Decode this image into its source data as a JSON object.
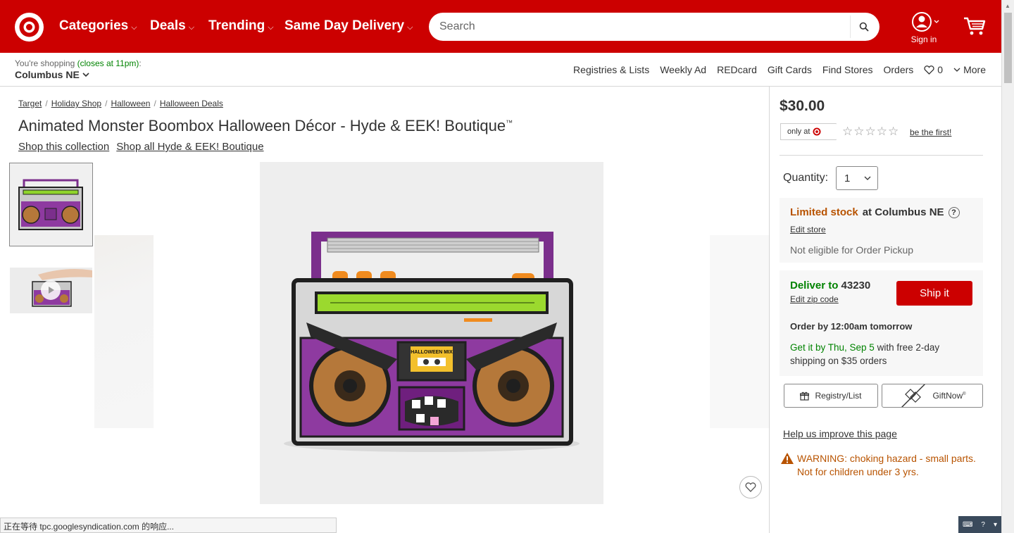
{
  "header": {
    "nav": [
      {
        "label": "Categories"
      },
      {
        "label": "Deals"
      },
      {
        "label": "Trending"
      },
      {
        "label": "Same Day Delivery"
      }
    ],
    "search_placeholder": "Search",
    "signin_label": "Sign in"
  },
  "subbar": {
    "shopping_prefix": "You're shopping",
    "shopping_hours": "(closes at 11pm)",
    "shopping_colon": ":",
    "store": "Columbus NE",
    "links": [
      "Registries & Lists",
      "Weekly Ad",
      "REDcard",
      "Gift Cards",
      "Find Stores",
      "Orders"
    ],
    "wishlist_count": "0",
    "more_label": "More"
  },
  "breadcrumb": [
    "Target",
    "Holiday Shop",
    "Halloween",
    "Halloween Deals"
  ],
  "product": {
    "title": "Animated Monster Boombox Halloween Décor - Hyde & EEK! Boutique",
    "trademark": "™",
    "collection_links": [
      "Shop this collection",
      "Shop all Hyde & EEK! Boutique"
    ],
    "boombox_cassette_label": "HALLOWEEN MIX"
  },
  "buybox": {
    "price": "$30.00",
    "only_at": "only at",
    "be_first": "be the first!",
    "rating_stars": 0,
    "quantity_label": "Quantity:",
    "quantity_value": "1",
    "stock_status": "Limited stock",
    "stock_location": "at Columbus NE",
    "help_mark": "?",
    "edit_store": "Edit store",
    "pickup_note": "Not eligible for Order Pickup",
    "deliver_label": "Deliver to",
    "zip": "43230",
    "edit_zip": "Edit zip code",
    "ship_button": "Ship it",
    "order_by": "Order by 12:00am tomorrow",
    "get_it_green": "Get it by Thu, Sep 5",
    "get_it_rest": " with free 2-day shipping on $35 orders",
    "registry_button": "Registry/List",
    "giftnow_button": "GiftNow",
    "giftnow_mark": "®",
    "help_link": "Help us improve this page",
    "warning": "WARNING: choking hazard - small parts. Not for children under 3 yrs."
  },
  "status_bar": "正在等待 tpc.googlesyndication.com 的响应...",
  "colors": {
    "brand_red": "#cc0000",
    "stock_orange": "#b85300",
    "delivery_green": "#008300"
  }
}
